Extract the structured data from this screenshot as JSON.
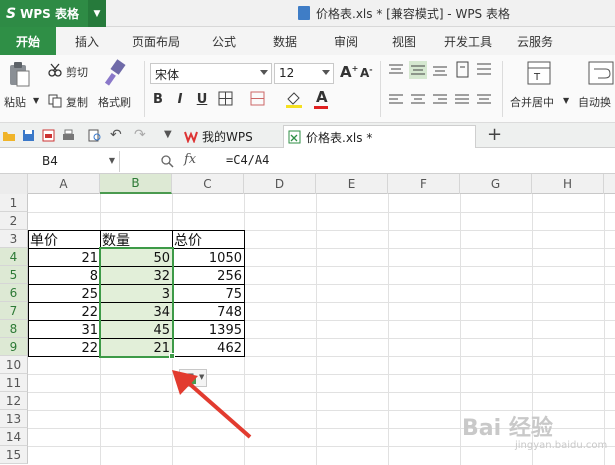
{
  "app": {
    "badge": "WPS 表格",
    "window_title": "价格表.xls * [兼容模式] - WPS 表格"
  },
  "ribbon": {
    "tabs": [
      {
        "label": "开始",
        "active": true
      },
      {
        "label": "插入",
        "active": false
      },
      {
        "label": "页面布局",
        "active": false
      },
      {
        "label": "公式",
        "active": false
      },
      {
        "label": "数据",
        "active": false
      },
      {
        "label": "审阅",
        "active": false
      },
      {
        "label": "视图",
        "active": false
      },
      {
        "label": "开发工具",
        "active": false
      },
      {
        "label": "云服务",
        "active": false
      }
    ],
    "cut": "剪切",
    "paste": "粘贴",
    "copy": "复制",
    "format_painter": "格式刷",
    "font_name": "宋体",
    "font_size": "12",
    "bold": "B",
    "italic": "I",
    "underline": "U",
    "merge_center": "合并居中",
    "auto_wrap": "自动换"
  },
  "doc_tabs": {
    "my_wps": "我的WPS",
    "file": "价格表.xls *",
    "add": "+"
  },
  "formula_bar": {
    "name_box": "B4",
    "fx": "fx",
    "formula": "=C4/A4"
  },
  "grid": {
    "columns": [
      "A",
      "B",
      "C",
      "D",
      "E",
      "F",
      "G",
      "H"
    ],
    "rows": [
      "1",
      "2",
      "3",
      "4",
      "5",
      "6",
      "7",
      "8",
      "9",
      "10",
      "11",
      "12",
      "13",
      "14",
      "15"
    ],
    "headers": [
      "单价",
      "数量",
      "总价"
    ],
    "data": [
      [
        "21",
        "50",
        "1050"
      ],
      [
        "8",
        "32",
        "256"
      ],
      [
        "25",
        "3",
        "75"
      ],
      [
        "22",
        "34",
        "748"
      ],
      [
        "31",
        "45",
        "1395"
      ],
      [
        "22",
        "21",
        "462"
      ]
    ]
  },
  "watermark": {
    "text": "Bai 经验",
    "sub": "jingyan.baidu.com"
  },
  "colors": {
    "accent": "#2f8f46",
    "selection": "#3d9a47",
    "selection_fill": "#e2efd9",
    "arrow": "#e23b2f"
  }
}
